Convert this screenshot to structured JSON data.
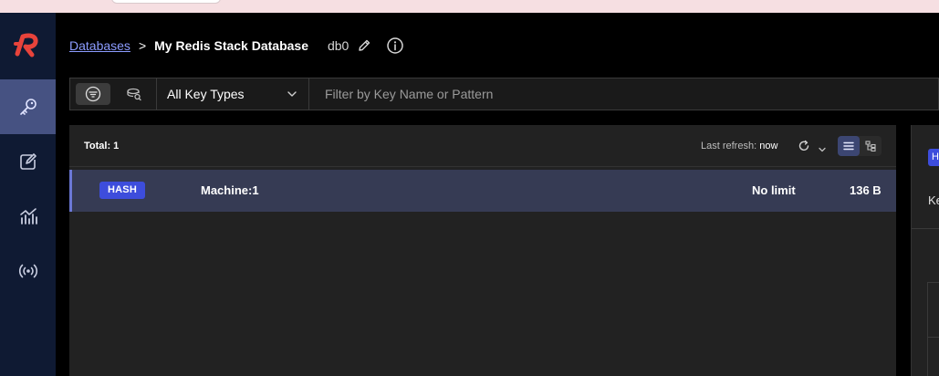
{
  "breadcrumb": {
    "databases_link": "Databases",
    "separator": ">",
    "database_name": "My Redis Stack Database",
    "db_index": "db0"
  },
  "filter": {
    "key_type_selected": "All Key Types",
    "search_placeholder": "Filter by Key Name or Pattern"
  },
  "list": {
    "total_label": "Total: 1",
    "last_refresh_label": "Last refresh:",
    "last_refresh_value": "now",
    "rows": [
      {
        "type": "HASH",
        "name": "Machine:1",
        "ttl": "No limit",
        "size": "136 B"
      }
    ]
  },
  "detail": {
    "badge": "H",
    "label": "Ke"
  },
  "colors": {
    "nav_bg": "#0f1a33",
    "nav_active": "#465282",
    "accent": "#3d4ddc",
    "link": "#8c9cff",
    "logo_red": "#e8433b"
  },
  "icons": [
    "redis-logo-icon",
    "key-icon",
    "workbench-icon",
    "analytics-icon",
    "pubsub-icon",
    "pencil-icon",
    "info-icon",
    "filter-icon",
    "search-stack-icon",
    "chevron-down-icon",
    "refresh-icon",
    "list-view-icon",
    "tree-view-icon"
  ]
}
